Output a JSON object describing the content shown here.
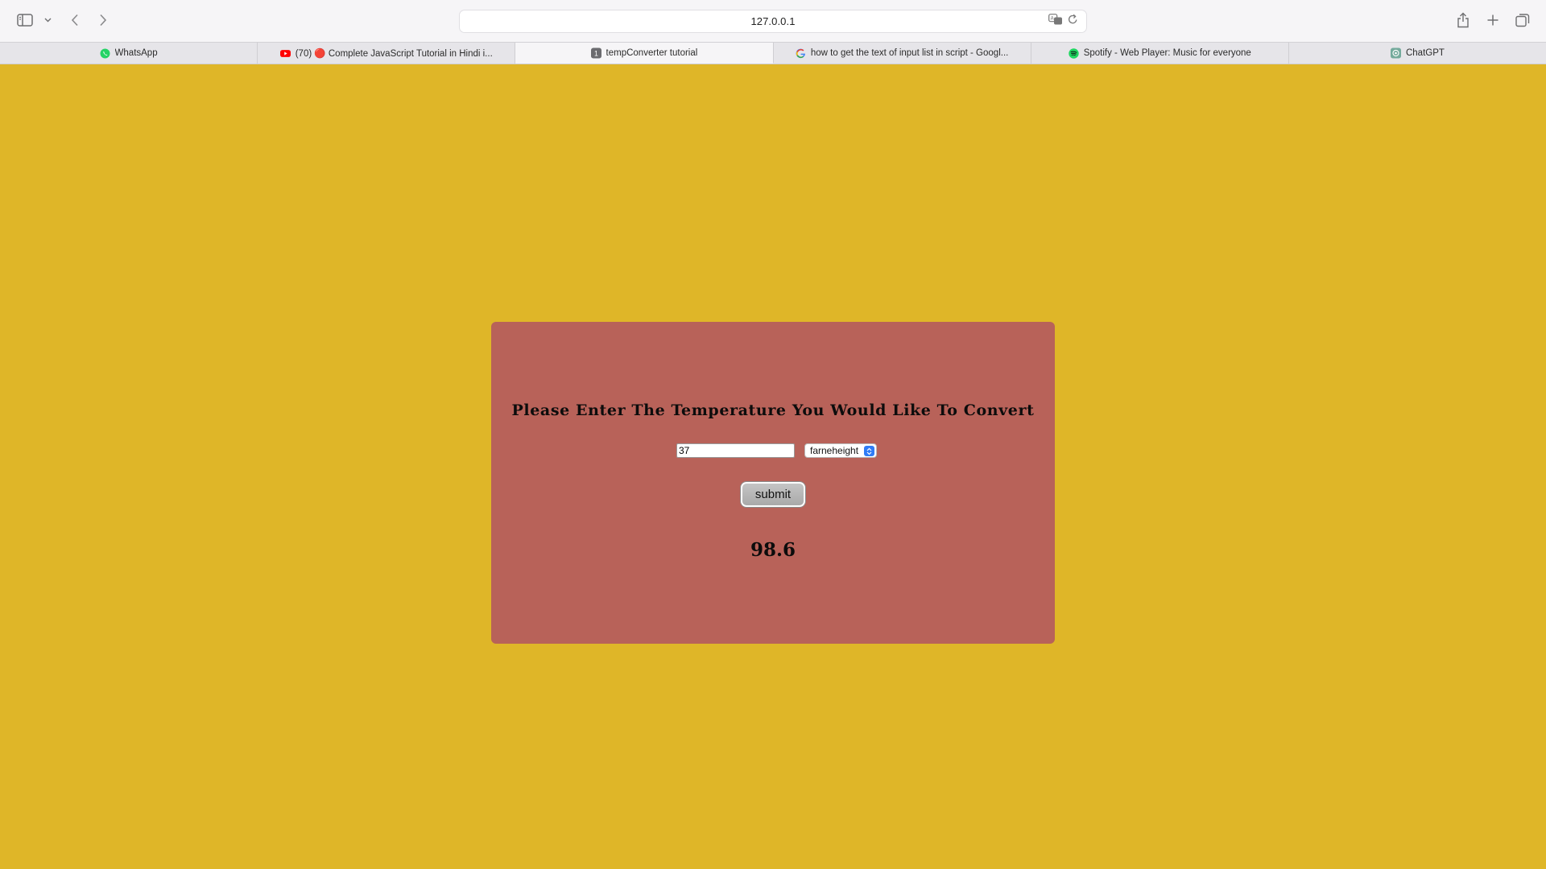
{
  "browser": {
    "address": "127.0.0.1",
    "tabs": [
      {
        "label": "WhatsApp",
        "icon": "whatsapp-icon",
        "color": "#25d366",
        "active": false
      },
      {
        "label": "(70) 🔴 Complete JavaScript Tutorial in Hindi i...",
        "icon": "youtube-icon",
        "color": "#ff0000",
        "active": false
      },
      {
        "label": "tempConverter tutorial",
        "icon": "page-number-icon",
        "icon_text": "1",
        "color": "#6b6b6f",
        "active": true
      },
      {
        "label": "how to get the text of input list in script - Googl...",
        "icon": "google-icon",
        "color": "#4285f4",
        "active": false
      },
      {
        "label": "Spotify - Web Player: Music for everyone",
        "icon": "spotify-icon",
        "color": "#1ed760",
        "active": false
      },
      {
        "label": "ChatGPT",
        "icon": "chatgpt-icon",
        "color": "#74aa9c",
        "active": false
      }
    ]
  },
  "page": {
    "background_color": "#dfb628",
    "card_color": "#b86259",
    "heading": "Please Enter The Temperature You Would Like To Convert",
    "input_value": "37",
    "unit_selected": "farneheight",
    "submit_label": "submit",
    "result": "98.6"
  }
}
